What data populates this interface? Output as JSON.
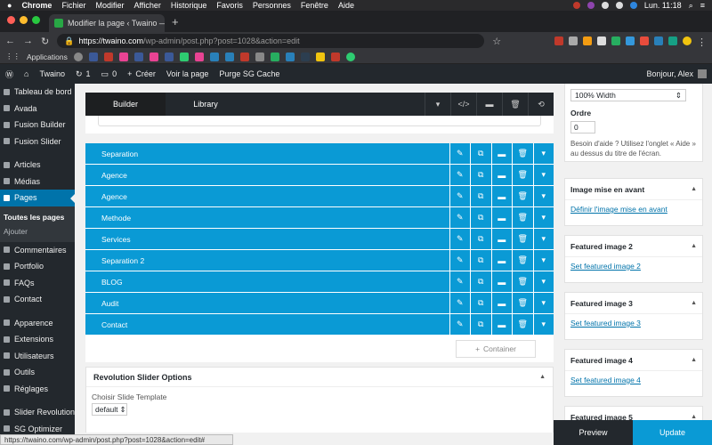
{
  "macos": {
    "app": "Chrome",
    "menus": [
      "Fichier",
      "Modifier",
      "Afficher",
      "Historique",
      "Favoris",
      "Personnes",
      "Fenêtre",
      "Aide"
    ],
    "clock": "Lun. 11:18"
  },
  "browser": {
    "tab_title": "Modifier la page ‹ Twaino — W",
    "url_host": "https://twaino.com",
    "url_path": "/wp-admin/post.php?post=1028&action=edit",
    "bookmarks_label": "Applications"
  },
  "wp_bar": {
    "site": "Twaino",
    "updates": "1",
    "comments": "0",
    "new": "Créer",
    "view": "Voir la page",
    "purge": "Purge SG Cache",
    "greeting": "Bonjour, Alex"
  },
  "sidebar": {
    "items": [
      {
        "label": "Tableau de bord"
      },
      {
        "label": "Avada"
      },
      {
        "label": "Fusion Builder"
      },
      {
        "label": "Fusion Slider"
      },
      {
        "label": "Articles"
      },
      {
        "label": "Médias"
      },
      {
        "label": "Pages"
      },
      {
        "label": "Commentaires"
      },
      {
        "label": "Portfolio"
      },
      {
        "label": "FAQs"
      },
      {
        "label": "Contact"
      },
      {
        "label": "Apparence"
      },
      {
        "label": "Extensions"
      },
      {
        "label": "Utilisateurs"
      },
      {
        "label": "Outils"
      },
      {
        "label": "Réglages"
      },
      {
        "label": "Slider Revolution"
      },
      {
        "label": "SG Optimizer"
      }
    ],
    "sub": [
      "Toutes les pages",
      "Ajouter"
    ]
  },
  "builder": {
    "tab_builder": "Builder",
    "tab_library": "Library",
    "rows": [
      "Separation",
      "Agence",
      "Agence",
      "Methode",
      "Services",
      "Separation 2",
      "BLOG",
      "Audit",
      "Contact"
    ],
    "add_container": "Container"
  },
  "revslider": {
    "title": "Revolution Slider Options",
    "label": "Choisir Slide Template",
    "value": "default"
  },
  "right": {
    "width_value": "100% Width",
    "order_label": "Ordre",
    "order_value": "0",
    "help": "Besoin d'aide ? Utilisez l'onglet « Aide » au dessus du titre de l'écran.",
    "boxes": [
      {
        "title": "Image mise en avant",
        "link": "Définir l'image mise en avant"
      },
      {
        "title": "Featured image 2",
        "link": "Set featured image 2"
      },
      {
        "title": "Featured image 3",
        "link": "Set featured image 3"
      },
      {
        "title": "Featured image 4",
        "link": "Set featured image 4"
      },
      {
        "title": "Featured image 5",
        "link": ""
      }
    ]
  },
  "footer": {
    "preview": "Preview",
    "update": "Update",
    "status_url": "https://twaino.com/wp-admin/post.php?post=1028&action=edit#"
  }
}
